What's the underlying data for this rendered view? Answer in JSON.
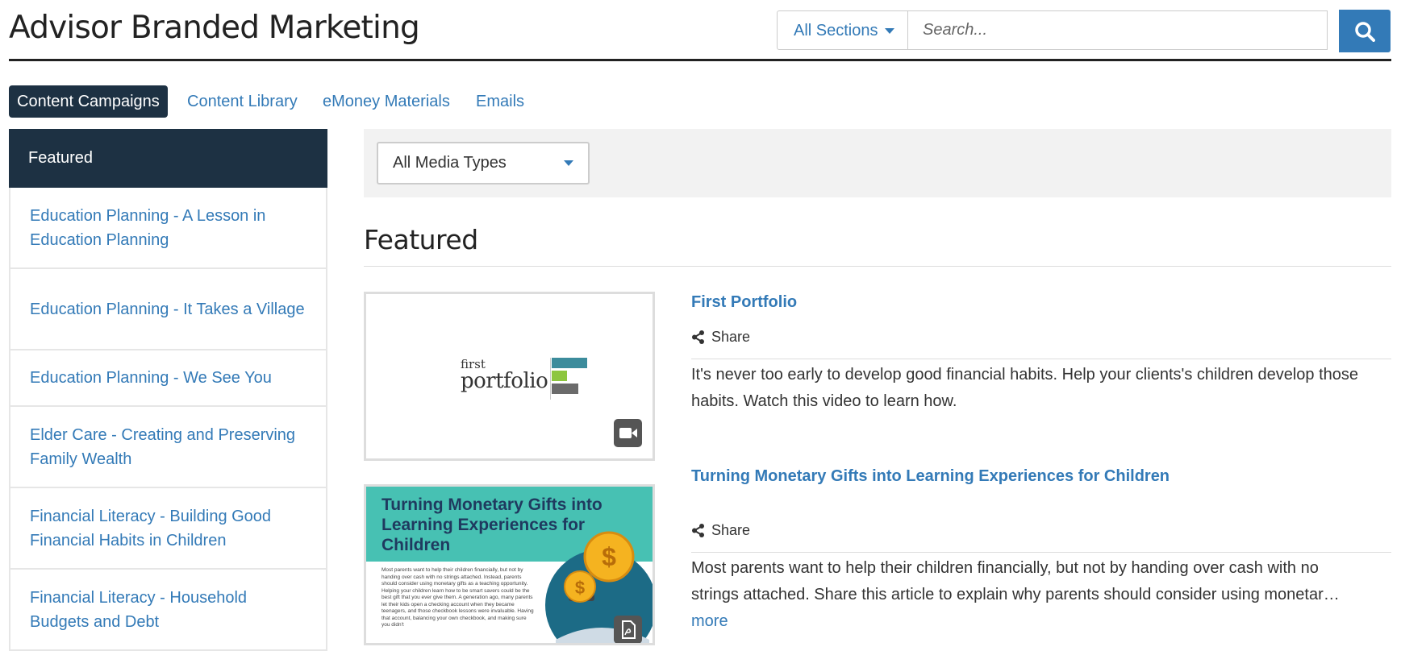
{
  "header": {
    "title": "Advisor Branded Marketing",
    "section_select": "All Sections",
    "search_placeholder": "Search...",
    "search_button": "search-icon"
  },
  "tabs": [
    {
      "label": "Content Campaigns",
      "active": true
    },
    {
      "label": "Content Library",
      "active": false
    },
    {
      "label": "eMoney Materials",
      "active": false
    },
    {
      "label": "Emails",
      "active": false
    }
  ],
  "sidebar": {
    "featured": "Featured",
    "items": [
      "Education Planning - A Lesson in Education Planning",
      "Education Planning - It Takes a Village",
      "Education Planning - We See You",
      "Elder Care - Creating and Preserving Family Wealth",
      "Financial Literacy - Building Good Financial Habits in Children",
      "Financial Literacy - Household Budgets and Debt"
    ]
  },
  "filter": {
    "media_type": "All Media Types"
  },
  "main": {
    "heading": "Featured",
    "items": [
      {
        "title": "First Portfolio",
        "share_label": "Share",
        "description": "It's never too early to develop good financial habits. Help your clients's children develop those habits. Watch this video to learn how.",
        "media_icon": "video-camera-icon",
        "thumb": {
          "logo_small": "first",
          "logo_large": "portfolio"
        }
      },
      {
        "title": "Turning Monetary Gifts into Learning Experiences for Children",
        "share_label": "Share",
        "description_line1": "Most parents want to help their children financially, but not by handing over cash with no",
        "description_line2": "strings attached. Share this article to explain why parents should consider using monetar…",
        "more_label": "more",
        "media_icon": "pdf-icon",
        "thumb": {
          "headline": "Turning Monetary Gifts into Learning Experiences for Children",
          "body": "Most parents want to help their children financially, but not by handing over cash with no strings attached. Instead, parents should consider using monetary gifts as a teaching opportunity. Helping your children learn how to be smart savers could be the best gift that you ever give them. A generation ago, many parents let their kids open a checking account when they became teenagers, and those checkbook lessons were invaluable. Having that account, balancing your own checkbook, and making sure you didn't"
        }
      }
    ]
  },
  "colors": {
    "link": "#337ab7",
    "nav_dark": "#1d3143",
    "thumb_teal": "#47c1b3"
  }
}
